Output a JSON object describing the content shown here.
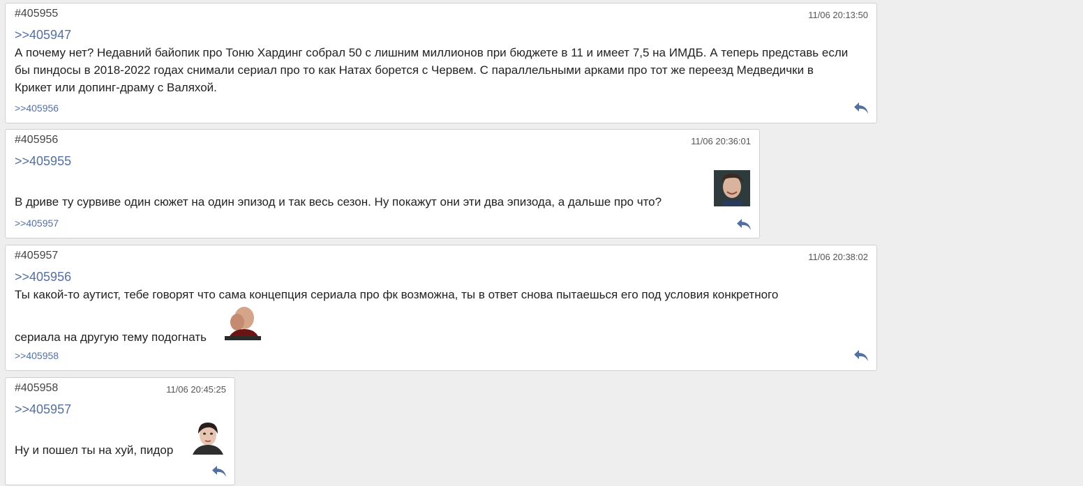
{
  "posts": [
    {
      "num": "#405955",
      "date": "11/06 20:13:50",
      "reply_to": ">>405947",
      "text": "А почему нет? Недавний байопик про Тоню Хардинг собрал 50 с лишним миллионов при бюджете в 11 и имеет 7,5 на ИМДБ. А теперь представь если бы пиндосы в 2018-2022 годах снимали сериал про то как Натах борется с Червем. С параллельными арками про тот же переезд Медведички в Крикет или допинг-драму с Валяхой.",
      "answer": ">>405956"
    },
    {
      "num": "#405956",
      "date": "11/06 20:36:01",
      "reply_to": ">>405955",
      "text": "В дриве ту сурвиве один сюжет на один эпизод и так весь сезон. Ну покажут они эти два эпизода, а дальше про что?",
      "answer": ">>405957"
    },
    {
      "num": "#405957",
      "date": "11/06 20:38:02",
      "reply_to": ">>405956",
      "text_line1": "Ты какой-то аутист, тебе говорят что сама концепция сериала про фк возможна, ты в ответ снова пытаешься его под условия конкретного",
      "text_line2": "сериала на другую тему подогнать",
      "answer": ">>405958"
    },
    {
      "num": "#405958",
      "date": "11/06 20:45:25",
      "reply_to": ">>405957",
      "text": "Ну и пошел ты на хуй, пидор"
    }
  ],
  "icons": {
    "reply": "reply-arrow-icon",
    "accent": "#5470a0"
  }
}
